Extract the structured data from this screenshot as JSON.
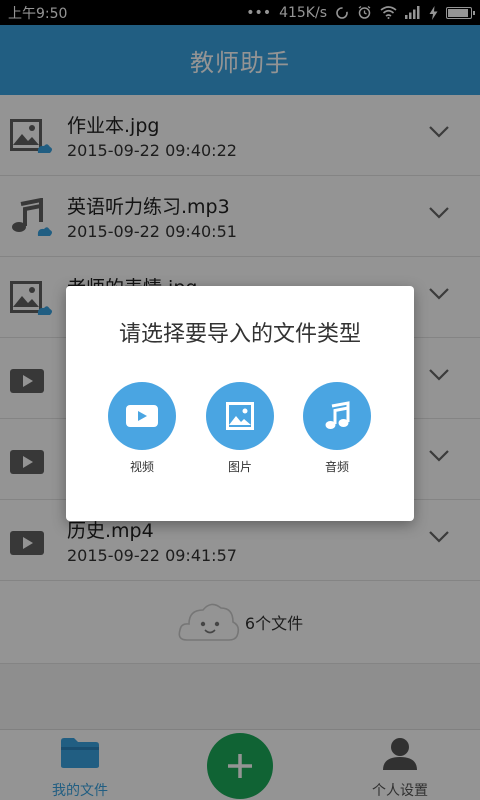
{
  "status_bar": {
    "time": "上午9:50",
    "dots": "•••",
    "speed": "415K/s"
  },
  "app_bar": {
    "title": "教师助手"
  },
  "files": [
    {
      "name": "作业本.jpg",
      "date": "2015-09-22 09:40:22",
      "kind": "image-icon"
    },
    {
      "name": "英语听力练习.mp3",
      "date": "2015-09-22 09:40:51",
      "kind": "music-icon"
    },
    {
      "name": "老师的表情.jpg",
      "date": "",
      "kind": "image-icon"
    },
    {
      "name": "",
      "date": "",
      "kind": "video-icon"
    },
    {
      "name": "",
      "date": "",
      "kind": "video-icon"
    },
    {
      "name": "历史.mp4",
      "date": "2015-09-22 09:41:57",
      "kind": "video-icon"
    }
  ],
  "summary": {
    "count": "6个文件"
  },
  "bottom_nav": {
    "files_label": "我的文件",
    "settings_label": "个人设置"
  },
  "dialog": {
    "title": "请选择要导入的文件类型",
    "video_label": "视频",
    "image_label": "图片",
    "audio_label": "音频"
  },
  "colors": {
    "primary": "#39a3e0",
    "fab": "#1dab5b",
    "choice": "#4aa5e2",
    "icon_gray": "#616161"
  }
}
